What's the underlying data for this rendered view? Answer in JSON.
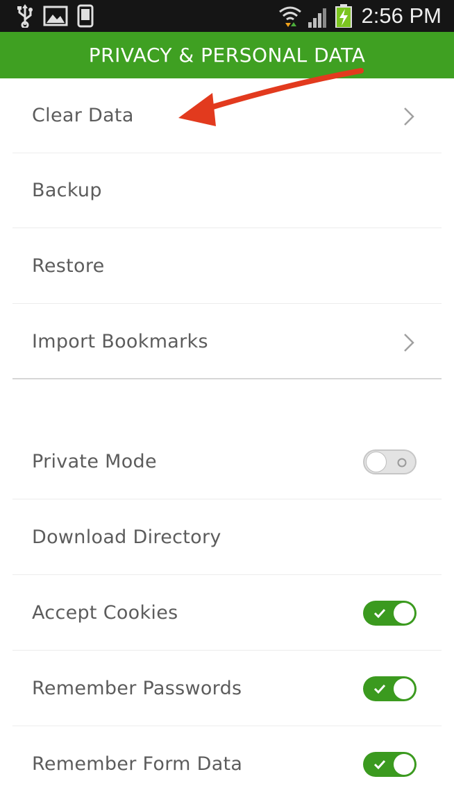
{
  "status_bar": {
    "time": "2:56 PM",
    "icons": [
      "usb-icon",
      "image-icon",
      "phone-icon",
      "wifi-icon",
      "signal-icon",
      "battery-charging-icon"
    ]
  },
  "header": {
    "title": "PRIVACY & PERSONAL DATA"
  },
  "colors": {
    "accent": "#3fa022",
    "toggle_on": "#3b9a1f",
    "arrow": "#e23a1e"
  },
  "sections": {
    "data_items": [
      {
        "label": "Clear Data",
        "has_chevron": true
      },
      {
        "label": "Backup",
        "has_chevron": false
      },
      {
        "label": "Restore",
        "has_chevron": false
      },
      {
        "label": "Import Bookmarks",
        "has_chevron": true
      }
    ],
    "settings": [
      {
        "label": "Private Mode",
        "toggle": false
      },
      {
        "label": "Download Directory",
        "toggle": null
      },
      {
        "label": "Accept Cookies",
        "toggle": true
      },
      {
        "label": "Remember Passwords",
        "toggle": true
      },
      {
        "label": "Remember Form Data",
        "toggle": true
      }
    ]
  },
  "annotation": {
    "type": "arrow",
    "points_to": "Clear Data"
  }
}
